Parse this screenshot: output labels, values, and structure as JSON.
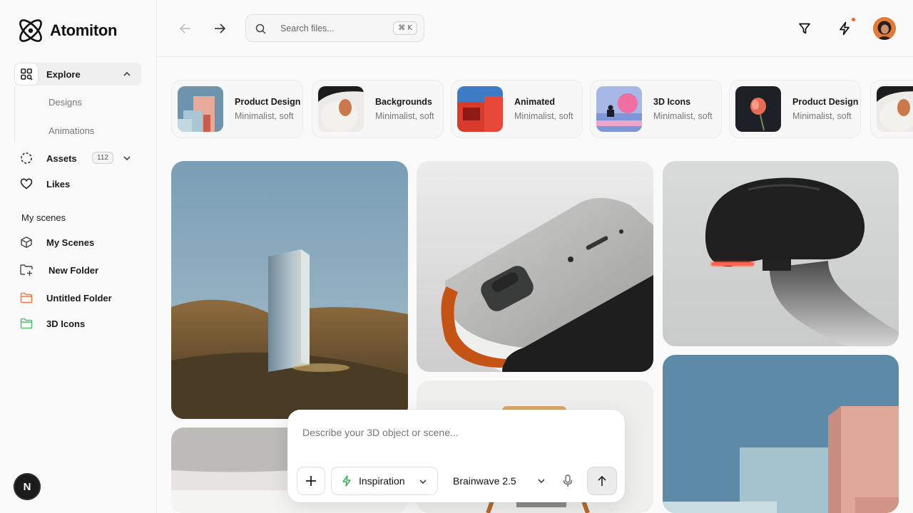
{
  "app": {
    "name": "Atomiton"
  },
  "sidebar": {
    "explore": {
      "label": "Explore"
    },
    "sub_items": [
      "Designs",
      "Animations"
    ],
    "assets": {
      "label": "Assets",
      "count": "112"
    },
    "likes": {
      "label": "Likes"
    },
    "section_label": "My scenes",
    "scenes": [
      {
        "label": "My Scenes",
        "icon": "cube-icon"
      },
      {
        "label": "New Folder",
        "icon": "folder-plus-icon"
      },
      {
        "label": "Untitled Folder",
        "icon": "folder-icon",
        "color": "#f07a3c"
      },
      {
        "label": "3D Icons",
        "icon": "folder-icon",
        "color": "#4cc26b"
      }
    ],
    "bottom_badge": "N"
  },
  "header": {
    "search_placeholder": "Search files...",
    "search_shortcut": "⌘ K"
  },
  "categories": [
    {
      "title": "Product Design",
      "subtitle": "Minimalist, soft"
    },
    {
      "title": "Backgrounds",
      "subtitle": "Minimalist, soft"
    },
    {
      "title": "Animated",
      "subtitle": "Minimalist, soft"
    },
    {
      "title": "3D Icons",
      "subtitle": "Minimalist, soft"
    },
    {
      "title": "Product Design",
      "subtitle": "Minimalist, soft"
    }
  ],
  "prompt": {
    "placeholder": "Describe your 3D object or scene...",
    "inspiration_label": "Inspiration",
    "model_label": "Brainwave 2.5"
  },
  "colors": {
    "accent": "#ff5a3c",
    "brand": "#111111"
  }
}
